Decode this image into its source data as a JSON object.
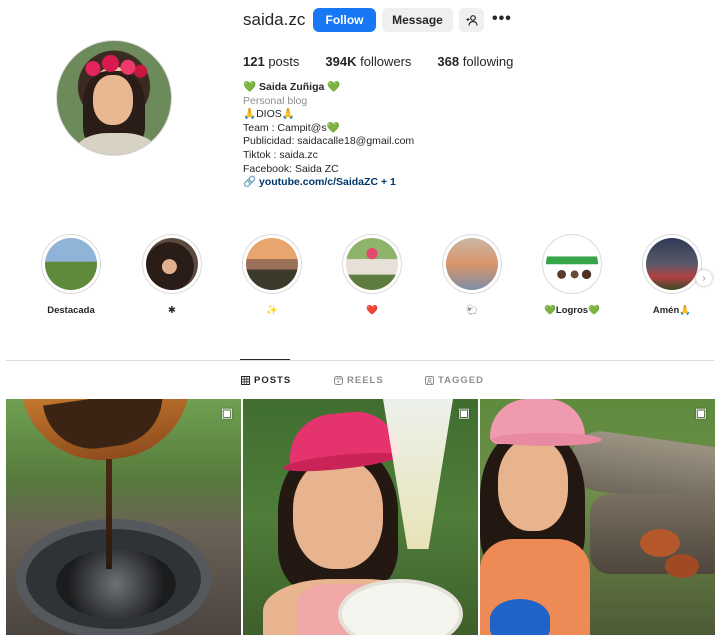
{
  "profile": {
    "username": "saida.zc",
    "buttons": {
      "follow": "Follow",
      "message": "Message",
      "suggest_icon": "person-add-icon",
      "more": "•••"
    },
    "stats": {
      "posts_count": "121",
      "posts_label": "posts",
      "followers_count": "394K",
      "followers_label": "followers",
      "following_count": "368",
      "following_label": "following"
    },
    "bio": {
      "name": "💚 Saida Zuñiga 💚",
      "category": "Personal blog",
      "lines": [
        "🙏DIOS🙏",
        "Team : Campit@s💚",
        "Publicidad: saidacalle18@gmail.com",
        "Tiktok : saida.zc",
        "Facebook: Saida ZC"
      ],
      "link_icon": "🔗",
      "link": "youtube.com/c/SaidaZC + 1"
    }
  },
  "highlights": [
    {
      "label": "Destacada"
    },
    {
      "label": "✱"
    },
    {
      "label": "✨"
    },
    {
      "label": "❤️"
    },
    {
      "label": "🐑"
    },
    {
      "label": "💚Logros💚"
    },
    {
      "label": "Amén🙏"
    }
  ],
  "tabs": {
    "posts": "POSTS",
    "reels": "REELS",
    "tagged": "TAGGED"
  },
  "colors": {
    "follow_button": "#1877f2",
    "link": "#00376b",
    "secondary_text": "#8e8e8e"
  }
}
